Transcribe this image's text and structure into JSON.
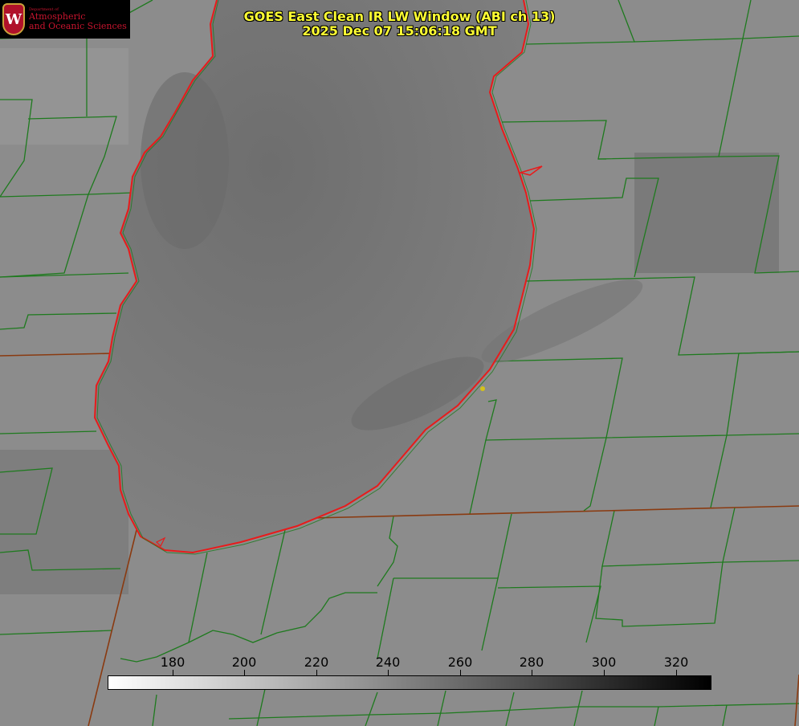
{
  "title": {
    "line1": "GOES East Clean IR LW Window (ABI ch 13)",
    "line2": "2025 Dec 07 15:06:18 GMT"
  },
  "logo": {
    "department": "Department of",
    "line1": "Atmospheric",
    "line2": "and Oceanic Sciences",
    "seal_letter": "W"
  },
  "colorbar": {
    "ticks": [
      "180",
      "200",
      "220",
      "240",
      "260",
      "280",
      "300",
      "320"
    ],
    "gradient_start": "#ffffff",
    "gradient_end": "#000000"
  },
  "colors": {
    "lake_outline": "#e81b1b",
    "county_lines": "#1e7a1e",
    "state_line": "#8a3a10",
    "marker": "#d4c21a"
  }
}
